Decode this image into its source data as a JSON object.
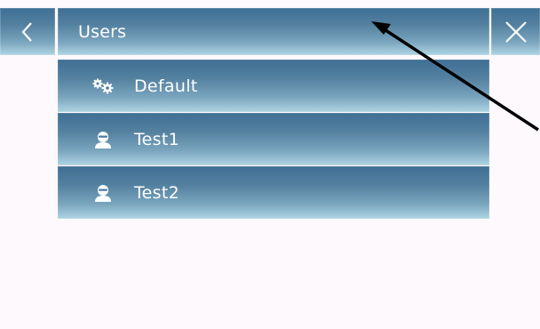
{
  "header": {
    "title": "Users",
    "back_icon": "chevron-left-icon",
    "close_icon": "close-icon"
  },
  "users": [
    {
      "label": "Default",
      "icon": "gears-icon"
    },
    {
      "label": "Test1",
      "icon": "user-icon"
    },
    {
      "label": "Test2",
      "icon": "user-icon"
    }
  ],
  "colors": {
    "background": "#fdf9fd",
    "bar_dark": "#3f6f95",
    "bar_light": "#b0d5e4",
    "text": "#ffffff",
    "arrow": "#000000"
  }
}
